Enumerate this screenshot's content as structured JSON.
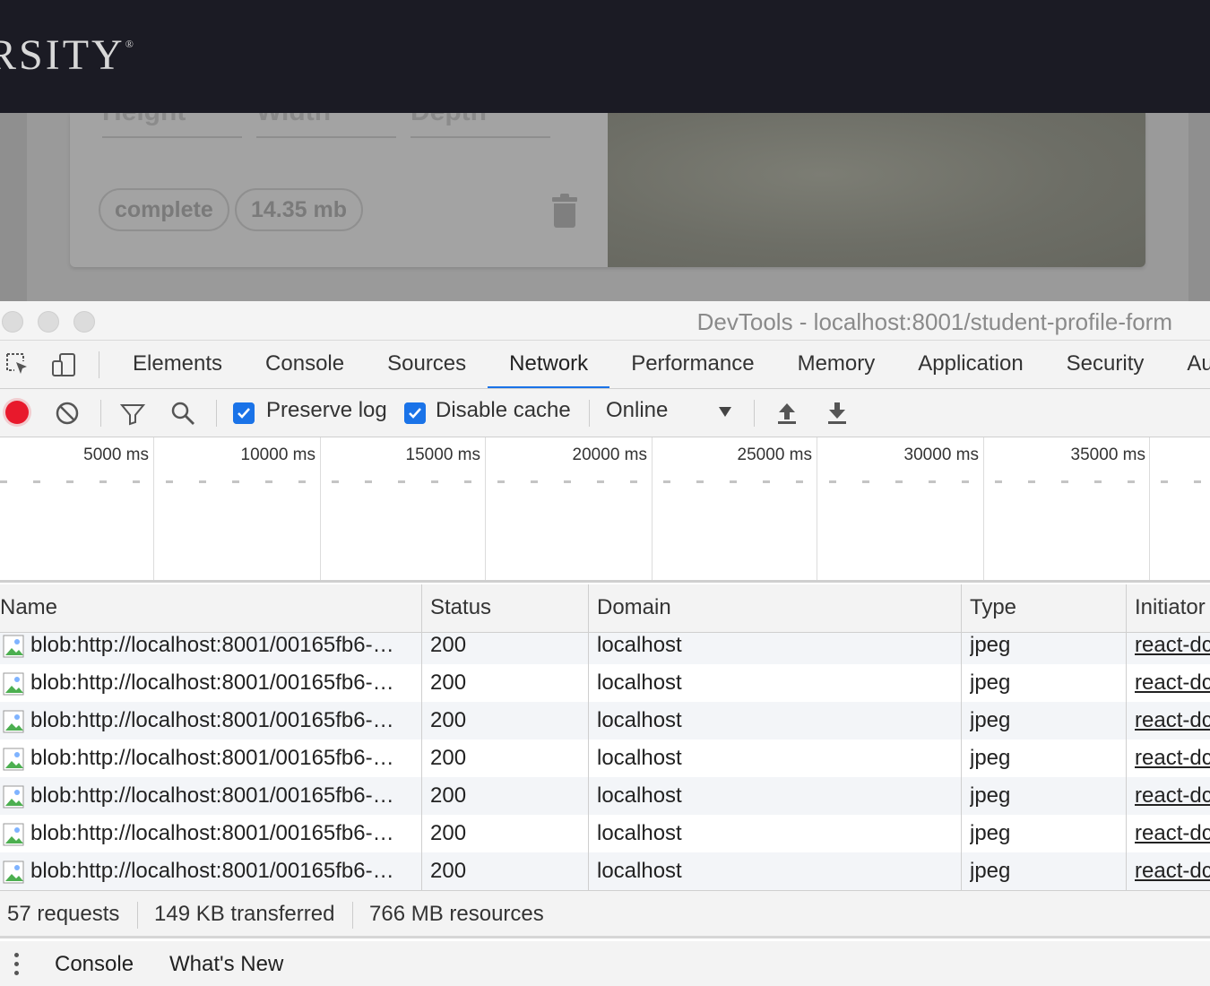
{
  "site": {
    "brand": "RSITY",
    "brand_mark": "®",
    "fields": [
      "Height",
      "Width",
      "Depth"
    ],
    "chips": [
      "complete",
      "14.35 mb"
    ]
  },
  "devtools": {
    "title": "DevTools - localhost:8001/student-profile-form",
    "tabs": [
      "Elements",
      "Console",
      "Sources",
      "Network",
      "Performance",
      "Memory",
      "Application",
      "Security",
      "Au"
    ],
    "active_tab": "Network",
    "toolbar": {
      "preserve_log": "Preserve log",
      "preserve_log_checked": true,
      "disable_cache": "Disable cache",
      "disable_cache_checked": true,
      "throttling": "Online"
    },
    "overview_ticks": [
      "5000 ms",
      "10000 ms",
      "15000 ms",
      "20000 ms",
      "25000 ms",
      "30000 ms",
      "35000 ms"
    ],
    "table": {
      "columns": [
        "Name",
        "Status",
        "Domain",
        "Type",
        "Initiator"
      ],
      "rows": [
        {
          "name": "blob:http://localhost:8001/00165fb6-…",
          "status": "200",
          "domain": "localhost",
          "type": "jpeg",
          "initiator": "react-dc"
        },
        {
          "name": "blob:http://localhost:8001/00165fb6-…",
          "status": "200",
          "domain": "localhost",
          "type": "jpeg",
          "initiator": "react-dc"
        },
        {
          "name": "blob:http://localhost:8001/00165fb6-…",
          "status": "200",
          "domain": "localhost",
          "type": "jpeg",
          "initiator": "react-dc"
        },
        {
          "name": "blob:http://localhost:8001/00165fb6-…",
          "status": "200",
          "domain": "localhost",
          "type": "jpeg",
          "initiator": "react-dc"
        },
        {
          "name": "blob:http://localhost:8001/00165fb6-…",
          "status": "200",
          "domain": "localhost",
          "type": "jpeg",
          "initiator": "react-dc"
        },
        {
          "name": "blob:http://localhost:8001/00165fb6-…",
          "status": "200",
          "domain": "localhost",
          "type": "jpeg",
          "initiator": "react-dc"
        },
        {
          "name": "blob:http://localhost:8001/00165fb6-…",
          "status": "200",
          "domain": "localhost",
          "type": "jpeg",
          "initiator": "react-dc"
        }
      ]
    },
    "summary": {
      "requests": "57 requests",
      "transferred": "149 KB transferred",
      "resources": "766 MB resources"
    },
    "drawer_tabs": [
      "Console",
      "What's New"
    ]
  },
  "colors": {
    "accent": "#1a73e8",
    "record": "#e8192c",
    "header_bg": "#1b1b24"
  },
  "icons": [
    "inspect-element-icon",
    "device-toolbar-icon",
    "record-icon",
    "clear-icon",
    "filter-icon",
    "search-icon",
    "throttle-caret-icon",
    "import-har-icon",
    "export-har-icon",
    "image-file-icon",
    "more-menu-icon"
  ]
}
